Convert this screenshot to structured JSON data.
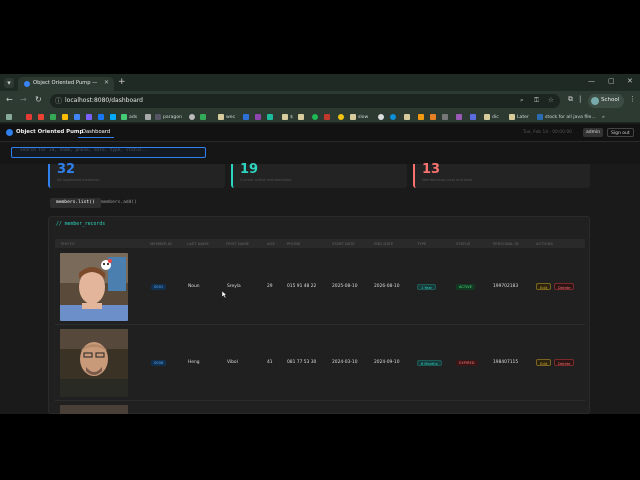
{
  "browser": {
    "tab_title": "Object Oriented Pump — Dashb",
    "url": "localhost:8080/dashboard",
    "profile_name": "School",
    "bookmarks": [
      "ads",
      "paragon",
      "wec",
      "$",
      "slow",
      "dic",
      "Later",
      "stock for all java file..."
    ]
  },
  "app": {
    "brand": "Object Oriented Pump",
    "nav_tab": "Dashboard",
    "clock": "Tue, Feb 14 · 00:00:00",
    "role": "admin",
    "signout": "Sign out",
    "command_placeholder": "search for id, name, phone, date, type, status..."
  },
  "stats": [
    {
      "value": "32",
      "label": "All registered members",
      "color": "#2f80ed"
    },
    {
      "value": "19",
      "label": "Current active memberships",
      "color": "#2dd4bf"
    },
    {
      "value": "13",
      "label": "Memberships past end date",
      "color": "#f87171"
    }
  ],
  "subtabs": [
    {
      "label": "members.list()",
      "active": true
    },
    {
      "label": "members.add()",
      "active": false
    }
  ],
  "panel_title": "// member_records",
  "columns": [
    "PHOTO",
    "MEMBER ID",
    "LAST NAME",
    "FIRST NAME",
    "AGE",
    "PHONE",
    "START DATE",
    "END DATE",
    "TYPE",
    "STATUS",
    "PERSONAL ID",
    "ACTIONS"
  ],
  "rows": [
    {
      "member_id": "0001",
      "last_name": "Noun",
      "first_name": "Sreyla",
      "age": "29",
      "phone": "015 91 48 22",
      "start_date": "2025-08-10",
      "end_date": "2026-08-10",
      "type": "1 Year",
      "status": "ACTIVE",
      "personal_id": "199702183",
      "edit": "Edit",
      "delete": "Delete"
    },
    {
      "member_id": "0006",
      "last_name": "Heng",
      "first_name": "Vibol",
      "age": "41",
      "phone": "081 77 53 30",
      "start_date": "2024-03-10",
      "end_date": "2024-09-10",
      "type": "6 Months",
      "status": "EXPIRED",
      "personal_id": "198407115",
      "edit": "Edit",
      "delete": "Delete"
    }
  ],
  "colors": {
    "accent": "#2f80ed",
    "active": "#22c55e",
    "expired": "#ef4444",
    "edit": "#d4a72c",
    "teal": "#2dd4bf"
  }
}
